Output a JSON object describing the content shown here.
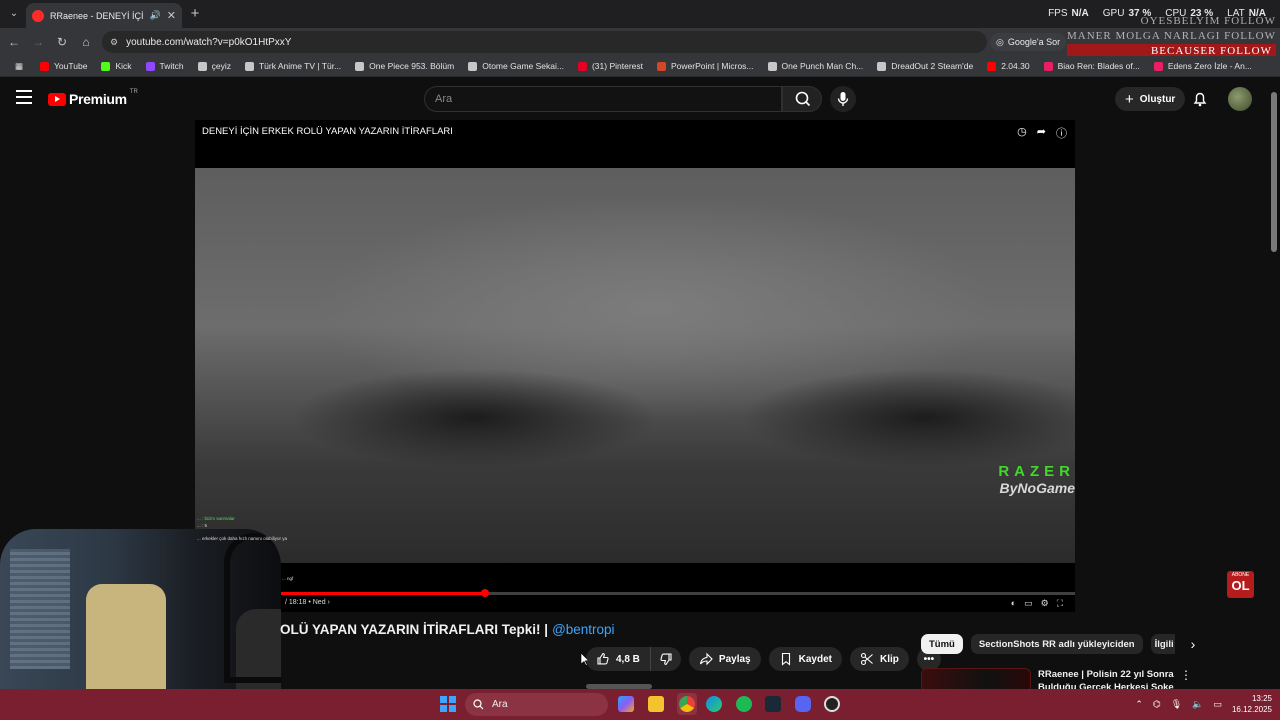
{
  "browser": {
    "tab_title": "RRaenee - DENEYİ İÇİN ER...",
    "url": "youtube.com/watch?v=p0kO1HtPxxY",
    "google_ask": "Google'a Sor",
    "bookmarks": [
      {
        "label": "YouTube",
        "color": "#ff0000"
      },
      {
        "label": "Kick",
        "color": "#53fc18"
      },
      {
        "label": "Twitch",
        "color": "#9146ff"
      },
      {
        "label": "çeyiz",
        "color": "#c7c7c7"
      },
      {
        "label": "Türk Anime TV | Tür...",
        "color": "#c7c7c7"
      },
      {
        "label": "One Piece 953. Bölüm",
        "color": "#c7c7c7"
      },
      {
        "label": "Otome Game Sekai...",
        "color": "#c7c7c7"
      },
      {
        "label": "(31) Pinterest",
        "color": "#e60023"
      },
      {
        "label": "PowerPoint | Micros...",
        "color": "#d24726"
      },
      {
        "label": "One Punch Man Ch...",
        "color": "#c7c7c7"
      },
      {
        "label": "DreadOut 2 Steam'de",
        "color": "#c7c7c7"
      },
      {
        "label": "2.04.30",
        "color": "#ff0000"
      },
      {
        "label": "Biao Ren: Blades of...",
        "color": "#e91e63"
      },
      {
        "label": "Edens Zero İzle - An...",
        "color": "#e91e63"
      }
    ]
  },
  "overlay": {
    "fps_label": "FPS",
    "fps_value": "N/A",
    "gpu_label": "GPU",
    "gpu_value": "37 %",
    "cpu_label": "CPU",
    "cpu_value": "23 %",
    "lat_label": "LAT",
    "lat_value": "N/A",
    "follows": [
      "OYESBELYIM FOLLOW",
      "MANER MOLGA  NARLAGI FOLLOW",
      "BECAUSER FOLLOW"
    ]
  },
  "youtube": {
    "logo_text": "Premium",
    "country_code": "TR",
    "search_placeholder": "Ara",
    "create_label": "Oluştur",
    "video_overlay_title": "DENEYİ İÇİN ERKEK ROLÜ YAPAN YAZARIN İTİRAFLARI",
    "watermark_line1": "RAZER",
    "watermark_line2": "ByNoGame",
    "progress_fraction": 0.33,
    "time_text": "/ 18:18 • Ned ›",
    "page_title": "OLÜ YAPAN YAZARIN İTİRAFLARI Tepki! |",
    "channel_handle": "@bentropi",
    "like_count": "4,8 B",
    "share_label": "Paylaş",
    "save_label": "Kaydet",
    "clip_label": "Klip",
    "chips": [
      "Tümü",
      "SectionShots RR adlı yükleyiciden",
      "İlgili"
    ],
    "rec_title": "RRaenee | Polisin 22 yıl Sonra Bulduğu Gerçek Herkesi Şoke",
    "abone_top": "ABONE",
    "abone_bottom": "OL"
  },
  "chat_overlay": [
    "... : bizim sanmalar",
    "...  : 5",
    "... erkekler çok daha hızlı namını olabiliyor ya",
    "... ngf"
  ],
  "taskbar": {
    "search_placeholder": "Ara",
    "time": "13:25",
    "date": "16.12.2025"
  }
}
